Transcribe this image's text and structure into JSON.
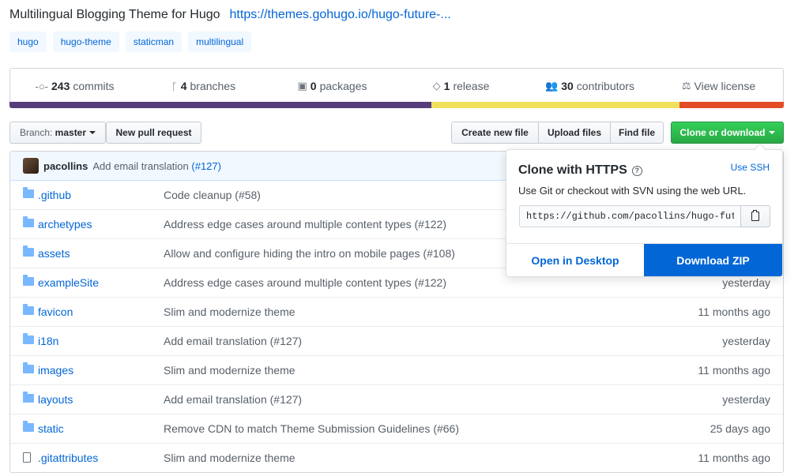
{
  "repo": {
    "description": "Multilingual Blogging Theme for Hugo",
    "homepage": "https://themes.gohugo.io/hugo-future-...",
    "topics": [
      "hugo",
      "hugo-theme",
      "staticman",
      "multilingual"
    ]
  },
  "summary": {
    "commits": {
      "num": "243",
      "label": "commits"
    },
    "branches": {
      "num": "4",
      "label": "branches"
    },
    "packages": {
      "num": "0",
      "label": "packages"
    },
    "releases": {
      "num": "1",
      "label": "release"
    },
    "contributors": {
      "num": "30",
      "label": "contributors"
    },
    "license": {
      "label": "View license"
    }
  },
  "language_bar": [
    {
      "color": "#563d7c",
      "share": 54.5
    },
    {
      "color": "#f1e05a",
      "share": 32.0
    },
    {
      "color": "#e34c26",
      "share": 13.5
    }
  ],
  "toolbar": {
    "branch_prefix": "Branch:",
    "branch": "master",
    "new_pr": "New pull request",
    "create_file": "Create new file",
    "upload_files": "Upload files",
    "find_file": "Find file",
    "clone": "Clone or download"
  },
  "latest_commit": {
    "author": "pacollins",
    "message": "Add email translation",
    "ref": "(#127)"
  },
  "files": [
    {
      "type": "dir",
      "name": ".github",
      "message": "Code cleanup (#58)",
      "age": ""
    },
    {
      "type": "dir",
      "name": "archetypes",
      "message": "Address edge cases around multiple content types (#122)",
      "age": ""
    },
    {
      "type": "dir",
      "name": "assets",
      "message": "Allow and configure hiding the intro on mobile pages (#108)",
      "age": ""
    },
    {
      "type": "dir",
      "name": "exampleSite",
      "message": "Address edge cases around multiple content types (#122)",
      "age": "yesterday"
    },
    {
      "type": "dir",
      "name": "favicon",
      "message": "Slim and modernize theme",
      "age": "11 months ago"
    },
    {
      "type": "dir",
      "name": "i18n",
      "message": "Add email translation (#127)",
      "age": "yesterday"
    },
    {
      "type": "dir",
      "name": "images",
      "message": "Slim and modernize theme",
      "age": "11 months ago"
    },
    {
      "type": "dir",
      "name": "layouts",
      "message": "Add email translation (#127)",
      "age": "yesterday"
    },
    {
      "type": "dir",
      "name": "static",
      "message": "Remove CDN to match Theme Submission Guidelines (#66)",
      "age": "25 days ago"
    },
    {
      "type": "file",
      "name": ".gitattributes",
      "message": "Slim and modernize theme",
      "age": "11 months ago"
    }
  ],
  "clone_popup": {
    "title": "Clone with HTTPS",
    "help_icon": "question-icon",
    "use_ssh": "Use SSH",
    "help_text": "Use Git or checkout with SVN using the web URL.",
    "url": "https://github.com/pacollins/hugo-future-imperfect-slim.git",
    "open_desktop": "Open in Desktop",
    "download_zip": "Download ZIP"
  }
}
